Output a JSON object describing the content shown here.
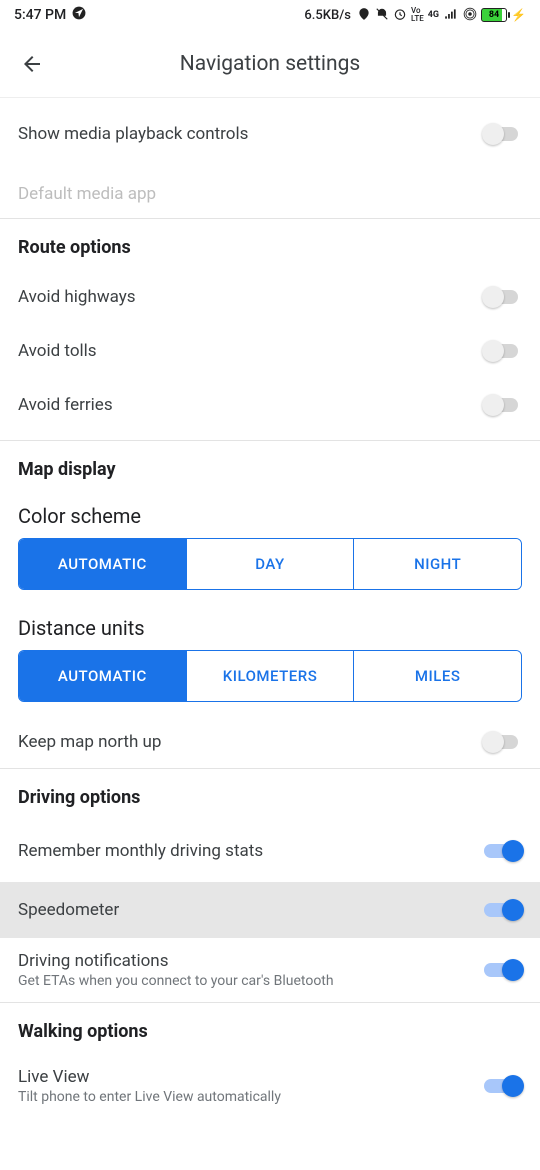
{
  "status": {
    "time": "5:47 PM",
    "net_speed": "6.5KB/s",
    "battery_pct": "84"
  },
  "header": {
    "title": "Navigation settings"
  },
  "rows": {
    "media_playback": "Show media playback controls",
    "default_media": "Default media app"
  },
  "route": {
    "header": "Route options",
    "avoid_highways": "Avoid highways",
    "avoid_tolls": "Avoid tolls",
    "avoid_ferries": "Avoid ferries"
  },
  "map_display": {
    "header": "Map display",
    "color_scheme_label": "Color scheme",
    "color_opts": {
      "auto": "AUTOMATIC",
      "day": "DAY",
      "night": "NIGHT"
    },
    "distance_label": "Distance units",
    "distance_opts": {
      "auto": "AUTOMATIC",
      "km": "KILOMETERS",
      "mi": "MILES"
    },
    "keep_north": "Keep map north up"
  },
  "driving": {
    "header": "Driving options",
    "remember_stats": "Remember monthly driving stats",
    "speedometer": "Speedometer",
    "notifications_title": "Driving notifications",
    "notifications_sub": "Get ETAs when you connect to your car's Bluetooth"
  },
  "walking": {
    "header": "Walking options",
    "live_view_title": "Live View",
    "live_view_sub": "Tilt phone to enter Live View automatically"
  }
}
